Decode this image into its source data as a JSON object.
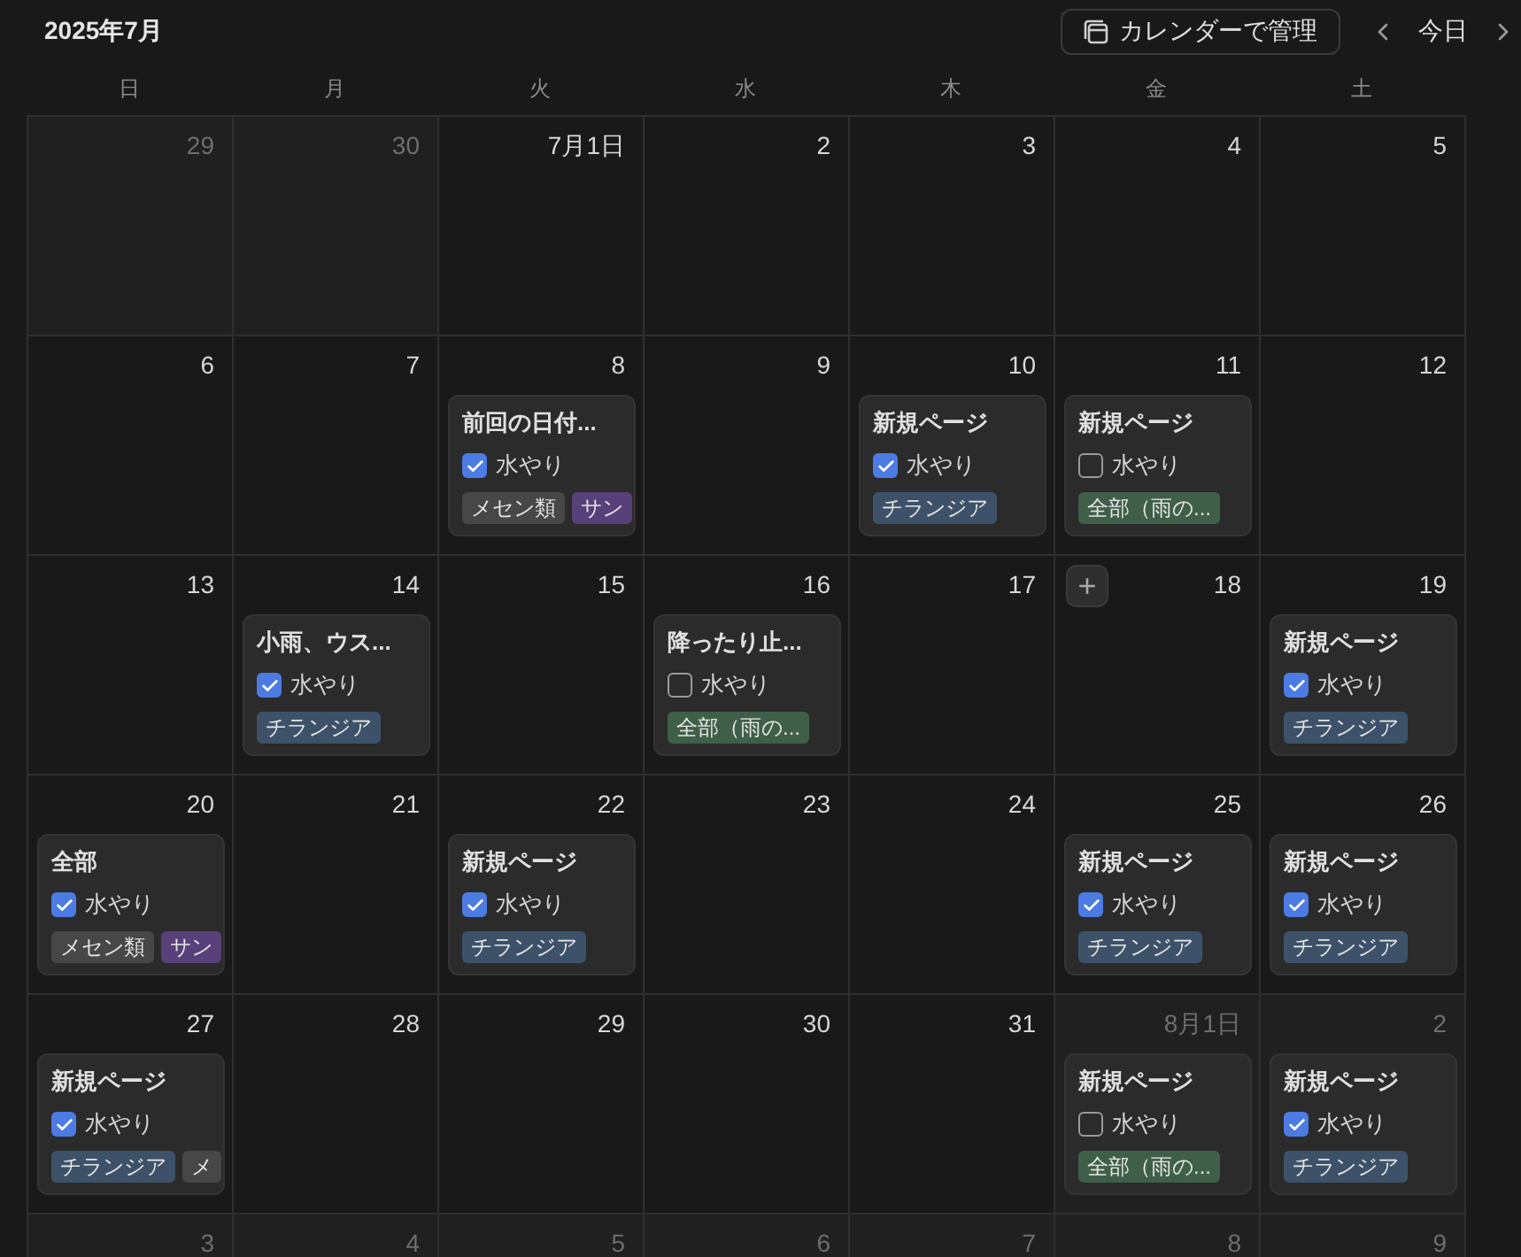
{
  "header": {
    "month": "2025年7月",
    "manage_button": "カレンダーで管理",
    "today_button": "今日"
  },
  "weekdays": [
    "日",
    "月",
    "火",
    "水",
    "木",
    "金",
    "土"
  ],
  "weeks": [
    {
      "days": [
        {
          "number": "29",
          "outside": true
        },
        {
          "number": "30",
          "outside": true
        },
        {
          "number": "7月1日",
          "outside": false
        },
        {
          "number": "2",
          "outside": false
        },
        {
          "number": "3",
          "outside": false
        },
        {
          "number": "4",
          "outside": false
        },
        {
          "number": "5",
          "outside": false
        }
      ]
    },
    {
      "days": [
        {
          "number": "6",
          "outside": false
        },
        {
          "number": "7",
          "outside": false
        },
        {
          "number": "8",
          "outside": false,
          "events": [
            {
              "title": "前回の日付...",
              "checkbox_label": "水やり",
              "checked": true,
              "tags": [
                {
                  "label": "メセン類",
                  "color": "#474747"
                },
                {
                  "label": "サン",
                  "color": "#58407a"
                }
              ]
            }
          ]
        },
        {
          "number": "9",
          "outside": false
        },
        {
          "number": "10",
          "outside": false,
          "events": [
            {
              "title": "新規ページ",
              "checkbox_label": "水やり",
              "checked": true,
              "tags": [
                {
                  "label": "チランジア",
                  "color": "#3d5269"
                }
              ]
            }
          ]
        },
        {
          "number": "11",
          "outside": false,
          "events": [
            {
              "title": "新規ページ",
              "checkbox_label": "水やり",
              "checked": false,
              "tags": [
                {
                  "label": "全部（雨の...",
                  "color": "#3f5f48"
                }
              ]
            }
          ]
        },
        {
          "number": "12",
          "outside": false
        }
      ]
    },
    {
      "days": [
        {
          "number": "13",
          "outside": false
        },
        {
          "number": "14",
          "outside": false,
          "events": [
            {
              "title": "小雨、ウス...",
              "checkbox_label": "水やり",
              "checked": true,
              "tags": [
                {
                  "label": "チランジア",
                  "color": "#3d5269"
                }
              ]
            }
          ]
        },
        {
          "number": "15",
          "outside": false
        },
        {
          "number": "16",
          "outside": false,
          "events": [
            {
              "title": "降ったり止...",
              "checkbox_label": "水やり",
              "checked": false,
              "tags": [
                {
                  "label": "全部（雨の...",
                  "color": "#3f5f48"
                }
              ]
            }
          ]
        },
        {
          "number": "17",
          "outside": false
        },
        {
          "number": "18",
          "outside": false,
          "add_button": "+"
        },
        {
          "number": "19",
          "outside": false,
          "events": [
            {
              "title": "新規ページ",
              "checkbox_label": "水やり",
              "checked": true,
              "tags": [
                {
                  "label": "チランジア",
                  "color": "#3d5269"
                }
              ]
            }
          ]
        }
      ]
    },
    {
      "days": [
        {
          "number": "20",
          "outside": false,
          "events": [
            {
              "title": "全部",
              "checkbox_label": "水やり",
              "checked": true,
              "tags": [
                {
                  "label": "メセン類",
                  "color": "#474747"
                },
                {
                  "label": "サン",
                  "color": "#58407a"
                }
              ]
            }
          ]
        },
        {
          "number": "21",
          "outside": false
        },
        {
          "number": "22",
          "outside": false,
          "events": [
            {
              "title": "新規ページ",
              "checkbox_label": "水やり",
              "checked": true,
              "tags": [
                {
                  "label": "チランジア",
                  "color": "#3d5269"
                }
              ]
            }
          ]
        },
        {
          "number": "23",
          "outside": false
        },
        {
          "number": "24",
          "outside": false
        },
        {
          "number": "25",
          "outside": false,
          "events": [
            {
              "title": "新規ページ",
              "checkbox_label": "水やり",
              "checked": true,
              "tags": [
                {
                  "label": "チランジア",
                  "color": "#3d5269"
                }
              ]
            }
          ]
        },
        {
          "number": "26",
          "outside": false,
          "events": [
            {
              "title": "新規ページ",
              "checkbox_label": "水やり",
              "checked": true,
              "tags": [
                {
                  "label": "チランジア",
                  "color": "#3d5269"
                }
              ]
            }
          ]
        }
      ]
    },
    {
      "days": [
        {
          "number": "27",
          "outside": false,
          "events": [
            {
              "title": "新規ページ",
              "checkbox_label": "水やり",
              "checked": true,
              "tags": [
                {
                  "label": "チランジア",
                  "color": "#3d5269"
                },
                {
                  "label": "メ",
                  "color": "#474747"
                }
              ]
            }
          ]
        },
        {
          "number": "28",
          "outside": false
        },
        {
          "number": "29",
          "outside": false
        },
        {
          "number": "30",
          "outside": false
        },
        {
          "number": "31",
          "outside": false
        },
        {
          "number": "8月1日",
          "outside": true,
          "events": [
            {
              "title": "新規ページ",
              "checkbox_label": "水やり",
              "checked": false,
              "tags": [
                {
                  "label": "全部（雨の...",
                  "color": "#3f5f48"
                }
              ]
            }
          ]
        },
        {
          "number": "2",
          "outside": true,
          "events": [
            {
              "title": "新規ページ",
              "checkbox_label": "水やり",
              "checked": true,
              "tags": [
                {
                  "label": "チランジア",
                  "color": "#3d5269"
                }
              ]
            }
          ]
        }
      ]
    },
    {
      "days": [
        {
          "number": "3",
          "outside": true
        },
        {
          "number": "4",
          "outside": true
        },
        {
          "number": "5",
          "outside": true
        },
        {
          "number": "6",
          "outside": true
        },
        {
          "number": "7",
          "outside": true
        },
        {
          "number": "8",
          "outside": true
        },
        {
          "number": "9",
          "outside": true
        }
      ]
    }
  ]
}
